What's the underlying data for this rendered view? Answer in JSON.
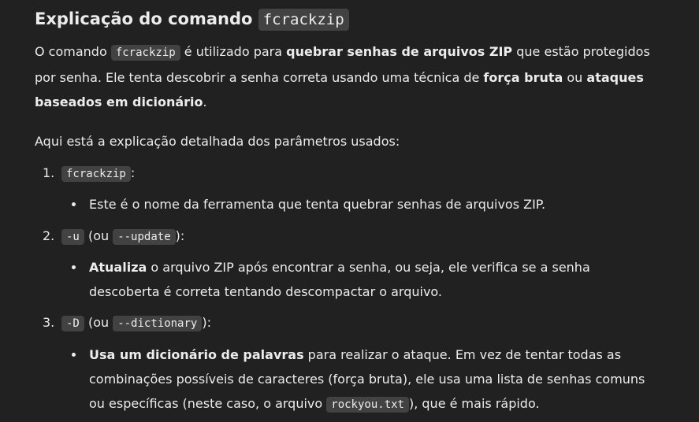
{
  "heading": {
    "text": "Explicação do comando ",
    "code": "fcrackzip"
  },
  "intro": {
    "t1": "O comando ",
    "code": "fcrackzip",
    "t2": " é utilizado para ",
    "b1": "quebrar senhas de arquivos ZIP",
    "t3": " que estão protegidos por senha. Ele tenta descobrir a senha correta usando uma técnica de ",
    "b2": "força bruta",
    "t4": " ou ",
    "b3": "ataques baseados em dicionário",
    "t5": "."
  },
  "lead": "Aqui está a explicação detalhada dos parâmetros usados:",
  "items": [
    {
      "num": "1.",
      "code1": "fcrackzip",
      "mid": "",
      "code2": "",
      "end": ":",
      "bullet_bold": "",
      "bullet_text": "Este é o nome da ferramenta que tenta quebrar senhas de arquivos ZIP."
    },
    {
      "num": "2.",
      "code1": "-u",
      "mid": " (ou ",
      "code2": "--update",
      "end": "):",
      "bullet_bold": "Atualiza",
      "bullet_text": " o arquivo ZIP após encontrar a senha, ou seja, ele verifica se a senha descoberta é correta tentando descompactar o arquivo."
    },
    {
      "num": "3.",
      "code1": "-D",
      "mid": " (ou ",
      "code2": "--dictionary",
      "end": "):",
      "bullet_bold": "Usa um dicionário de palavras",
      "bullet_text": " para realizar o ataque. Em vez de tentar todas as combinações possíveis de caracteres (força bruta), ele usa uma lista de senhas comuns ou específicas (neste caso, o arquivo ",
      "bullet_code": "rockyou.txt",
      "bullet_end": "), que é mais rápido."
    }
  ]
}
